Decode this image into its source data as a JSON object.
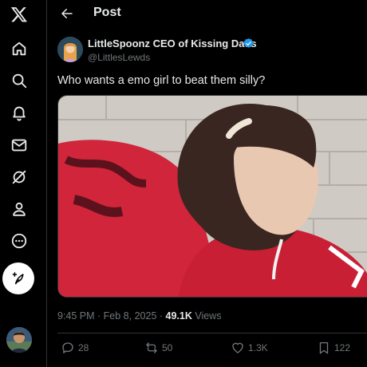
{
  "header": {
    "title": "Post"
  },
  "nav": {
    "items": [
      {
        "name": "x-logo",
        "icon": "x-logo-icon"
      },
      {
        "name": "home",
        "icon": "home-icon"
      },
      {
        "name": "explore",
        "icon": "search-icon"
      },
      {
        "name": "notifications",
        "icon": "bell-icon"
      },
      {
        "name": "messages",
        "icon": "mail-icon"
      },
      {
        "name": "grok",
        "icon": "grok-icon"
      },
      {
        "name": "profile",
        "icon": "person-icon"
      },
      {
        "name": "more",
        "icon": "more-icon"
      }
    ],
    "post_button_icon": "feather-plus-icon"
  },
  "tweet": {
    "display_name": "LittleSpoonz CEO of Kissing Dads",
    "handle": "@LittlesLewds",
    "text": "Who wants a emo girl to beat them silly?",
    "time": "9:45 PM",
    "separator": " · ",
    "date": "Feb 8, 2025",
    "views_count": "49.1K",
    "views_label": "Views"
  },
  "actions": {
    "replies": "28",
    "reposts": "50",
    "likes": "1.3K",
    "bookmarks": "122"
  },
  "colors": {
    "background": "#000000",
    "text": "#e7e9ea",
    "muted": "#71767b",
    "verified": "#1d9bf0",
    "border": "#2f3336"
  }
}
